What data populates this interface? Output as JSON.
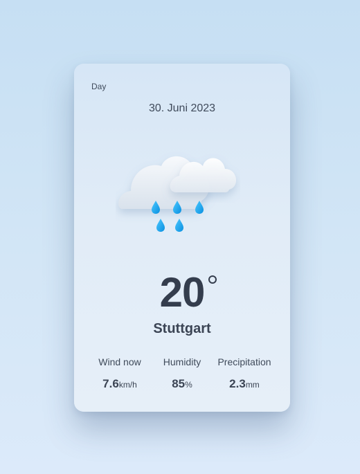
{
  "card": {
    "mode_label": "Day",
    "date": "30. Juni 2023",
    "icon": "cloud-rain-icon",
    "temperature": "20",
    "city": "Stuttgart"
  },
  "stats": [
    {
      "label": "Wind now",
      "value": "7.6",
      "unit": "km/h"
    },
    {
      "label": "Humidity",
      "value": "85",
      "unit": "%"
    },
    {
      "label": "Precipitation",
      "value": "2.3",
      "unit": "mm"
    }
  ],
  "colors": {
    "background": "#cfe3f5",
    "card": "#e1ecf7",
    "text": "#343d4d",
    "raindrop": "#1aa3f0"
  }
}
